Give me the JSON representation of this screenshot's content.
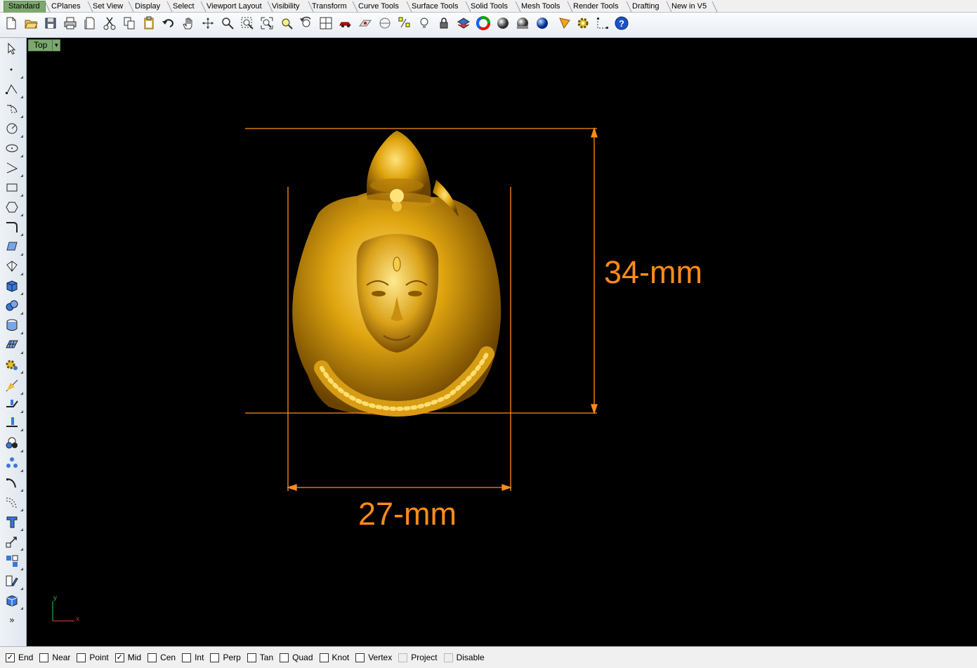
{
  "tabs": [
    "Standard",
    "CPlanes",
    "Set View",
    "Display",
    "Select",
    "Viewport Layout",
    "Visibility",
    "Transform",
    "Curve Tools",
    "Surface Tools",
    "Solid Tools",
    "Mesh Tools",
    "Render Tools",
    "Drafting",
    "New in V5"
  ],
  "active_tab": "Standard",
  "toolbar_icons": [
    "new-icon",
    "open-icon",
    "save-icon",
    "print-icon",
    "import-icon",
    "cut-icon",
    "copy-icon",
    "paste-icon",
    "undo-icon",
    "pan-hand-icon",
    "rotate-view-icon",
    "zoom-icon",
    "zoom-window-icon",
    "zoom-extents-icon",
    "zoom-selected-icon",
    "undo-view-icon",
    "four-viewports-icon",
    "car-icon",
    "cplane-icon",
    "grid-snap-icon",
    "select-points-icon",
    "light-icon",
    "lock-icon",
    "layer-icon",
    "color-wheel-icon",
    "shaded-sphere-icon",
    "rendered-sphere-icon",
    "blue-sphere-icon",
    "render-light-icon",
    "options-gear-icon",
    "dimension-icon",
    "help-icon"
  ],
  "viewport": {
    "name": "Top",
    "dimension_height": "34-mm",
    "dimension_width": "27-mm",
    "axis_x": "x",
    "axis_y": "y",
    "dimension_color": "#ff8c1a",
    "background": "#000000"
  },
  "osnaps": [
    {
      "label": "End",
      "checked": true,
      "enabled": true
    },
    {
      "label": "Near",
      "checked": false,
      "enabled": true
    },
    {
      "label": "Point",
      "checked": false,
      "enabled": true
    },
    {
      "label": "Mid",
      "checked": true,
      "enabled": true
    },
    {
      "label": "Cen",
      "checked": false,
      "enabled": true
    },
    {
      "label": "Int",
      "checked": false,
      "enabled": true
    },
    {
      "label": "Perp",
      "checked": false,
      "enabled": true
    },
    {
      "label": "Tan",
      "checked": false,
      "enabled": true
    },
    {
      "label": "Quad",
      "checked": false,
      "enabled": true
    },
    {
      "label": "Knot",
      "checked": false,
      "enabled": true
    },
    {
      "label": "Vertex",
      "checked": false,
      "enabled": true
    },
    {
      "label": "Project",
      "checked": false,
      "enabled": false
    },
    {
      "label": "Disable",
      "checked": false,
      "enabled": false
    }
  ]
}
